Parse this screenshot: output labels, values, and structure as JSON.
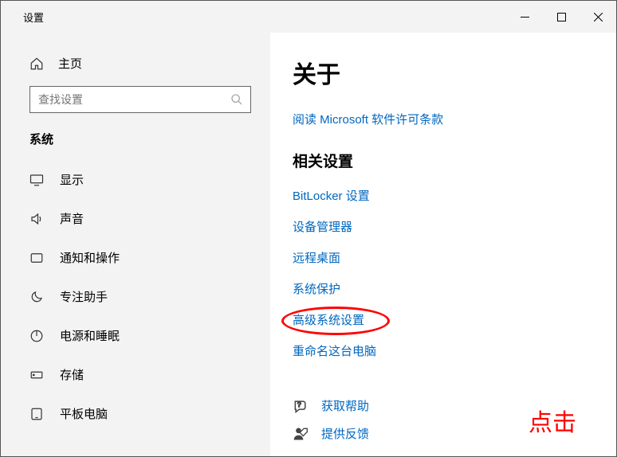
{
  "titlebar": {
    "title": "设置"
  },
  "sidebar": {
    "home_label": "主页",
    "search_placeholder": "查找设置",
    "section_label": "系统",
    "items": [
      {
        "label": "显示"
      },
      {
        "label": "声音"
      },
      {
        "label": "通知和操作"
      },
      {
        "label": "专注助手"
      },
      {
        "label": "电源和睡眠"
      },
      {
        "label": "存储"
      },
      {
        "label": "平板电脑"
      }
    ]
  },
  "main": {
    "page_title": "关于",
    "license_link": "阅读 Microsoft 软件许可条款",
    "related_heading": "相关设置",
    "related_links": [
      "BitLocker 设置",
      "设备管理器",
      "远程桌面",
      "系统保护",
      "高级系统设置",
      "重命名这台电脑"
    ],
    "highlighted_index": 4,
    "support": {
      "get_help": "获取帮助",
      "feedback": "提供反馈"
    }
  },
  "annotation": {
    "text": "点击"
  }
}
